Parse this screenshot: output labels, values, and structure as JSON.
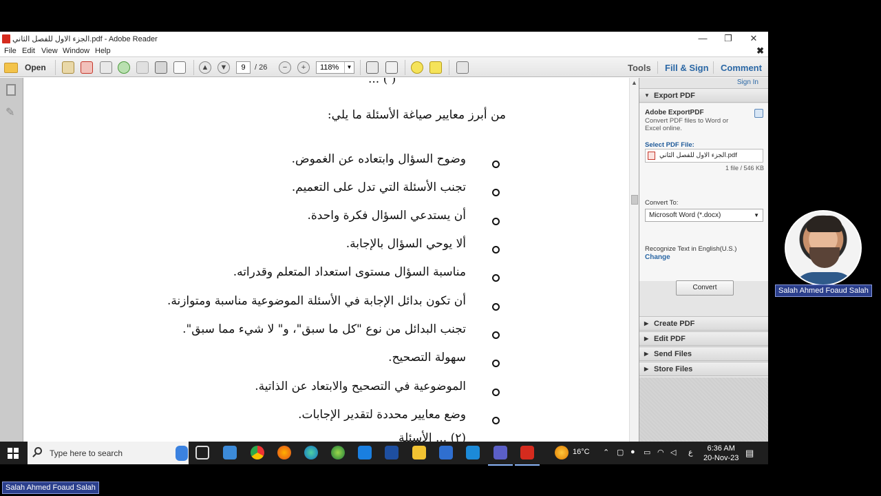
{
  "window": {
    "title": "الجزء الاول للفصل الثاني.pdf - Adobe Reader",
    "minimize": "—",
    "restore": "❐",
    "close": "✕"
  },
  "menu": {
    "items": [
      "File",
      "Edit",
      "View",
      "Window",
      "Help"
    ],
    "close": "✖"
  },
  "toolbar": {
    "open_label": "Open",
    "page_current": "9",
    "page_total": "/ 26",
    "zoom": "118%",
    "tools_label": "Tools",
    "fill_sign_label": "Fill & Sign",
    "comment_label": "Comment"
  },
  "document": {
    "top_partial": "( ) ...",
    "heading": "من أبرز معايير صياغة الأسئلة ما يلي:",
    "bullets": [
      "وضوح السؤال وابتعاده عن الغموض.",
      "تجنب الأسئلة التي تدل على التعميم.",
      "أن يستدعي السؤال فكرة واحدة.",
      "ألا يوحي السؤال بالإجابة.",
      "مناسبة السؤال مستوى استعداد المتعلم وقدراته.",
      "أن تكون بدائل الإجابة في الأسئلة الموضوعية مناسبة ومتوازنة.",
      "تجنب البدائل من نوع \"كل ما سبق\"، و\" لا شيء مما سبق\".",
      "سهولة التصحيح.",
      "الموضوعية في التصحيح والابتعاد عن الذاتية.",
      "وضع معايير محددة لتقدير الإجابات."
    ],
    "bottom_partial": "(٢) ... الأسئلة"
  },
  "right_pane": {
    "sign_in": "Sign In",
    "export_pdf": "Export PDF",
    "export_title": "Adobe ExportPDF",
    "export_desc": "Convert PDF files to Word or Excel online.",
    "select_file_label": "Select PDF File:",
    "file_name": "الجزء الاول للفصل الثاني.pdf",
    "file_count": "1 file / 546 KB",
    "convert_to_label": "Convert To:",
    "convert_to_value": "Microsoft Word (*.docx)",
    "recognize_text": "Recognize Text in English(U.S.)",
    "change_link": "Change",
    "convert_button": "Convert",
    "sections": [
      "Create PDF",
      "Edit PDF",
      "Send Files",
      "Store Files"
    ]
  },
  "taskbar": {
    "search_placeholder": "Type here to search",
    "weather": "16°C",
    "lang": "ع",
    "time": "6:36 AM",
    "date": "20-Nov-23"
  },
  "overlay": {
    "name_tag": "Salah Ahmed Foaud Salah",
    "name_tag_bottom": "Salah Ahmed Foaud Salah"
  },
  "colors": {
    "adobe_red": "#d52b1e",
    "link_blue": "#2a67a5",
    "taskbar": "#1f1f1f",
    "name_tag": "#2b3f8c"
  }
}
